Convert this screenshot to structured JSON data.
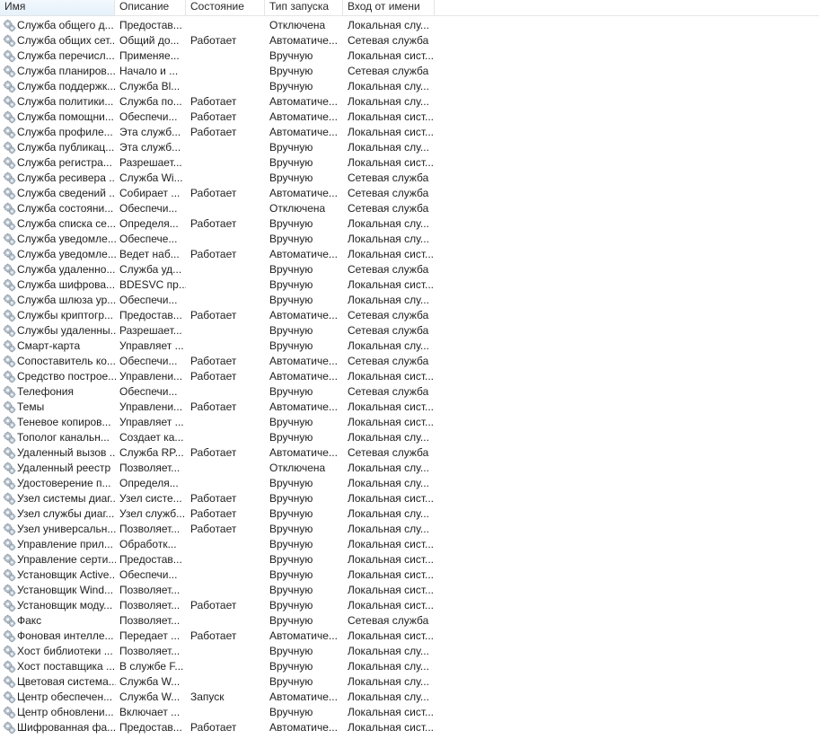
{
  "columns": [
    "Имя",
    "Описание",
    "Состояние",
    "Тип запуска",
    "Вход от имени"
  ],
  "rows": [
    [
      "Служба общего д...",
      "Предостав...",
      "",
      "Отключена",
      "Локальная слу..."
    ],
    [
      "Служба общих сет...",
      "Общий до...",
      "Работает",
      "Автоматиче...",
      "Сетевая служба"
    ],
    [
      "Служба перечисл...",
      "Применяе...",
      "",
      "Вручную",
      "Локальная сист..."
    ],
    [
      "Служба планиров...",
      "Начало и ...",
      "",
      "Вручную",
      "Сетевая служба"
    ],
    [
      "Служба поддержк...",
      "Служба Bl...",
      "",
      "Вручную",
      "Локальная слу..."
    ],
    [
      "Служба политики...",
      "Служба по...",
      "Работает",
      "Автоматиче...",
      "Локальная слу..."
    ],
    [
      "Служба помощни...",
      "Обеспечи...",
      "Работает",
      "Автоматиче...",
      "Локальная сист..."
    ],
    [
      "Служба профиле...",
      "Эта служб...",
      "Работает",
      "Автоматиче...",
      "Локальная сист..."
    ],
    [
      "Служба публикац...",
      "Эта служб...",
      "",
      "Вручную",
      "Локальная слу..."
    ],
    [
      "Служба регистра...",
      "Разрешает...",
      "",
      "Вручную",
      "Локальная сист..."
    ],
    [
      "Служба ресивера ...",
      "Служба Wi...",
      "",
      "Вручную",
      "Сетевая служба"
    ],
    [
      "Служба сведений ...",
      "Собирает ...",
      "Работает",
      "Автоматиче...",
      "Сетевая служба"
    ],
    [
      "Служба состояни...",
      "Обеспечи...",
      "",
      "Отключена",
      "Сетевая служба"
    ],
    [
      "Служба списка се...",
      "Определя...",
      "Работает",
      "Вручную",
      "Локальная слу..."
    ],
    [
      "Служба уведомле...",
      "Обеспече...",
      "",
      "Вручную",
      "Локальная слу..."
    ],
    [
      "Служба уведомле...",
      "Ведет наб...",
      "Работает",
      "Автоматиче...",
      "Локальная сист..."
    ],
    [
      "Служба удаленно...",
      "Служба уд...",
      "",
      "Вручную",
      "Сетевая служба"
    ],
    [
      "Служба шифрова...",
      "BDESVC пр...",
      "",
      "Вручную",
      "Локальная сист..."
    ],
    [
      "Служба шлюза ур...",
      "Обеспечи...",
      "",
      "Вручную",
      "Локальная слу..."
    ],
    [
      "Службы криптогр...",
      "Предостав...",
      "Работает",
      "Автоматиче...",
      "Сетевая служба"
    ],
    [
      "Службы удаленны...",
      "Разрешает...",
      "",
      "Вручную",
      "Сетевая служба"
    ],
    [
      "Смарт-карта",
      "Управляет ...",
      "",
      "Вручную",
      "Локальная слу..."
    ],
    [
      "Сопоставитель ко...",
      "Обеспечи...",
      "Работает",
      "Автоматиче...",
      "Сетевая служба"
    ],
    [
      "Средство построе...",
      "Управлени...",
      "Работает",
      "Автоматиче...",
      "Локальная сист..."
    ],
    [
      "Телефония",
      "Обеспечи...",
      "",
      "Вручную",
      "Сетевая служба"
    ],
    [
      "Темы",
      "Управлени...",
      "Работает",
      "Автоматиче...",
      "Локальная сист..."
    ],
    [
      "Теневое копиров...",
      "Управляет ...",
      "",
      "Вручную",
      "Локальная сист..."
    ],
    [
      "Тополог канальн...",
      "Создает ка...",
      "",
      "Вручную",
      "Локальная слу..."
    ],
    [
      "Удаленный вызов ...",
      "Служба RP...",
      "Работает",
      "Автоматиче...",
      "Сетевая служба"
    ],
    [
      "Удаленный реестр",
      "Позволяет...",
      "",
      "Отключена",
      "Локальная слу..."
    ],
    [
      "Удостоверение п...",
      "Определя...",
      "",
      "Вручную",
      "Локальная слу..."
    ],
    [
      "Узел системы диаг...",
      "Узел систе...",
      "Работает",
      "Вручную",
      "Локальная сист..."
    ],
    [
      "Узел службы диаг...",
      "Узел служб...",
      "Работает",
      "Вручную",
      "Локальная слу..."
    ],
    [
      "Узел универсальн...",
      "Позволяет...",
      "Работает",
      "Вручную",
      "Локальная слу..."
    ],
    [
      "Управление прил...",
      "Обработк...",
      "",
      "Вручную",
      "Локальная сист..."
    ],
    [
      "Управление серти...",
      "Предостав...",
      "",
      "Вручную",
      "Локальная сист..."
    ],
    [
      "Установщик Active...",
      "Обеспечи...",
      "",
      "Вручную",
      "Локальная сист..."
    ],
    [
      "Установщик Wind...",
      "Позволяет...",
      "",
      "Вручную",
      "Локальная сист..."
    ],
    [
      "Установщик моду...",
      "Позволяет...",
      "Работает",
      "Вручную",
      "Локальная сист..."
    ],
    [
      "Факс",
      "Позволяет...",
      "",
      "Вручную",
      "Сетевая служба"
    ],
    [
      "Фоновая интелле...",
      "Передает ...",
      "Работает",
      "Автоматиче...",
      "Локальная сист..."
    ],
    [
      "Хост библиотеки ...",
      "Позволяет...",
      "",
      "Вручную",
      "Локальная слу..."
    ],
    [
      "Хост поставщика ...",
      "В службе F...",
      "",
      "Вручную",
      "Локальная слу..."
    ],
    [
      "Цветовая система...",
      "Служба W...",
      "",
      "Вручную",
      "Локальная слу..."
    ],
    [
      "Центр обеспечен...",
      "Служба W...",
      "Запуск",
      "Автоматиче...",
      "Локальная слу..."
    ],
    [
      "Центр обновлени...",
      "Включает ...",
      "",
      "Вручную",
      "Локальная сист..."
    ],
    [
      "Шифрованная фа...",
      "Предостав...",
      "Работает",
      "Автоматиче...",
      "Локальная сист..."
    ]
  ]
}
